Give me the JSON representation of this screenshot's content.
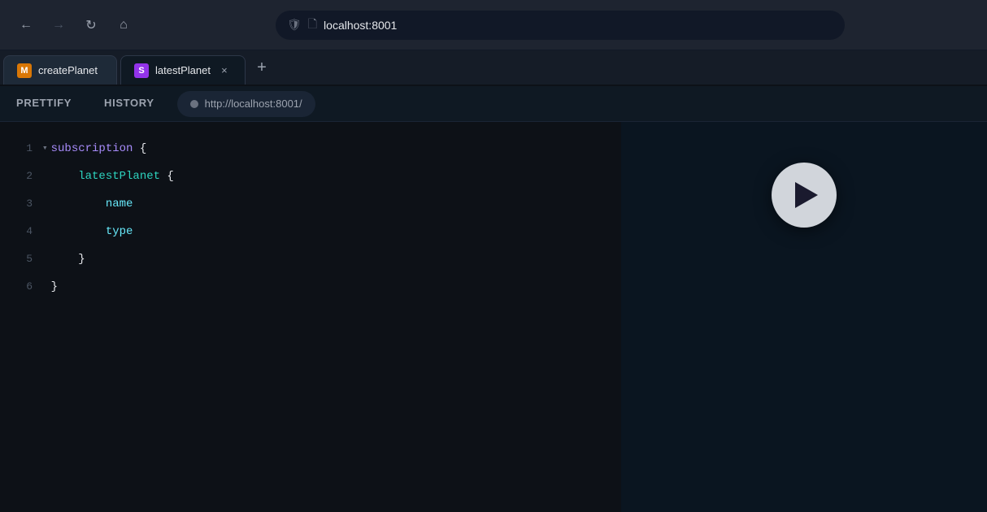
{
  "browser": {
    "address": "localhost:8001",
    "back_label": "←",
    "forward_label": "→",
    "reload_label": "↻",
    "home_label": "⌂"
  },
  "tabs": [
    {
      "id": "createPlanet",
      "label": "createPlanet",
      "favicon_letter": "M",
      "favicon_color": "orange",
      "active": false,
      "closeable": false
    },
    {
      "id": "latestPlanet",
      "label": "latestPlanet",
      "favicon_letter": "S",
      "favicon_color": "purple",
      "active": true,
      "closeable": true
    }
  ],
  "new_tab_label": "+",
  "toolbar": {
    "prettify_label": "PRETTIFY",
    "history_label": "HISTORY",
    "endpoint_dot": "●",
    "endpoint_url": "http://localhost:8001/"
  },
  "editor": {
    "lines": [
      {
        "number": "1",
        "toggle": "▾",
        "content": [
          {
            "text": "subscription",
            "class": "kw-purple"
          },
          {
            "text": " {",
            "class": "kw-white"
          }
        ]
      },
      {
        "number": "2",
        "toggle": "",
        "content": [
          {
            "text": "    latestPlanet",
            "class": "kw-teal"
          },
          {
            "text": " {",
            "class": "kw-white"
          }
        ]
      },
      {
        "number": "3",
        "toggle": "",
        "content": [
          {
            "text": "        name",
            "class": "kw-cyan"
          },
          {
            "text": "",
            "class": ""
          }
        ]
      },
      {
        "number": "4",
        "toggle": "",
        "content": [
          {
            "text": "        type",
            "class": "kw-cyan"
          },
          {
            "text": "",
            "class": ""
          }
        ]
      },
      {
        "number": "5",
        "toggle": "",
        "content": [
          {
            "text": "    }",
            "class": "kw-white"
          },
          {
            "text": "",
            "class": ""
          }
        ]
      },
      {
        "number": "6",
        "toggle": "",
        "content": [
          {
            "text": "}",
            "class": "kw-white"
          },
          {
            "text": "",
            "class": ""
          }
        ]
      }
    ]
  },
  "play_button_label": "Run"
}
